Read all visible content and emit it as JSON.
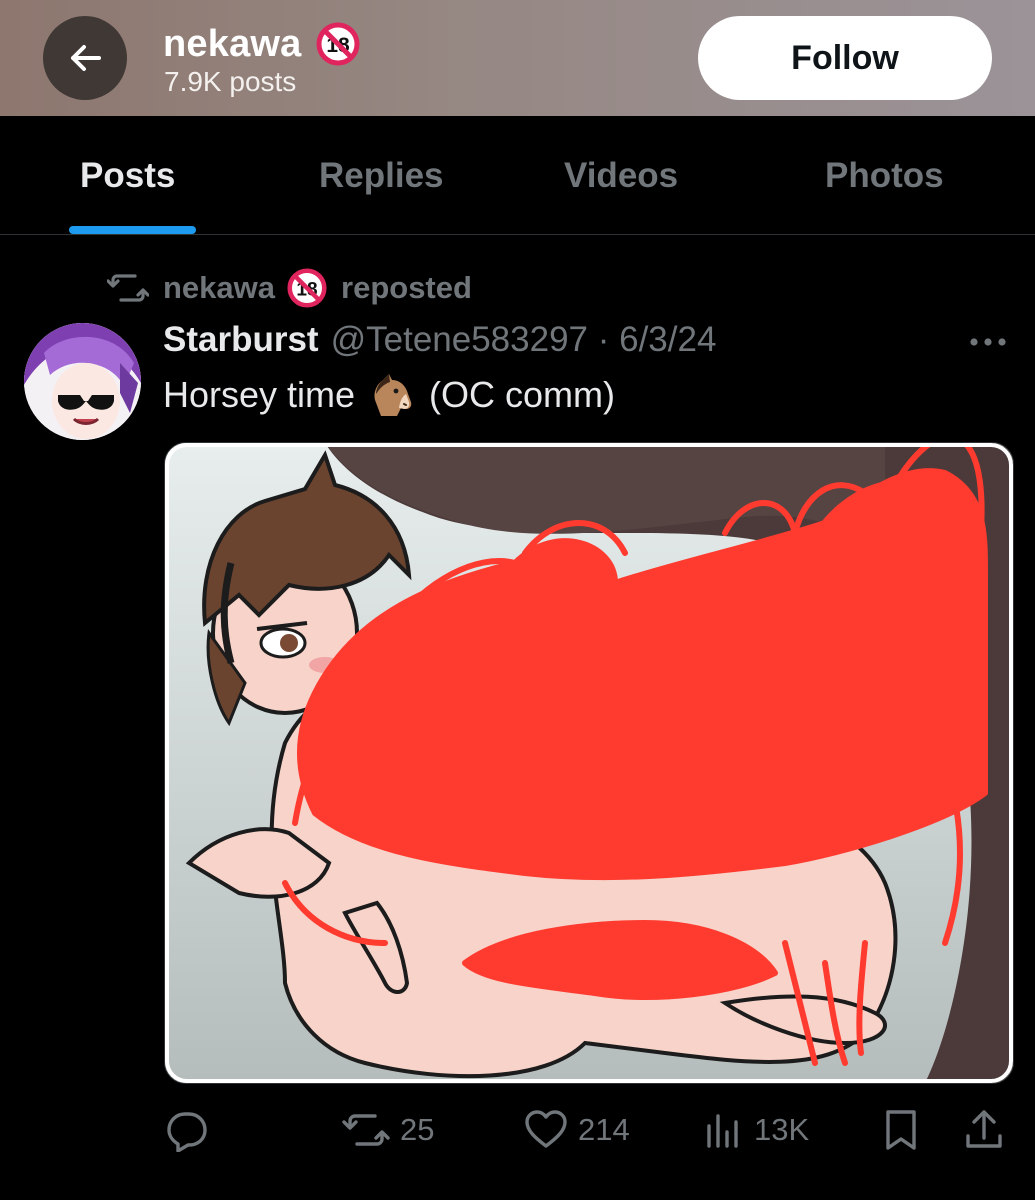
{
  "header": {
    "profile_name": "nekawa",
    "posts_count": "7.9K posts",
    "follow_label": "Follow"
  },
  "tabs": [
    {
      "label": "Posts",
      "active": true
    },
    {
      "label": "Replies",
      "active": false
    },
    {
      "label": "Videos",
      "active": false
    },
    {
      "label": "Photos",
      "active": false
    }
  ],
  "post": {
    "repost_by": "nekawa",
    "repost_label": "reposted",
    "author_name": "Starburst",
    "handle_date": "@Tetene583297 · 6/3/24",
    "text_before": "Horsey time",
    "text_after": "(OC comm)",
    "stats": {
      "reposts": "25",
      "likes": "214",
      "views": "13K"
    }
  },
  "icons": {
    "back": "arrow-left-icon",
    "adult_badge": "no-under-18-icon",
    "repost": "repost-icon",
    "more": "more-horizontal-icon",
    "emoji": "horse-face-emoji",
    "reply": "reply-icon",
    "like": "heart-icon",
    "views": "views-chart-icon",
    "bookmark": "bookmark-icon",
    "share": "share-icon"
  },
  "colors": {
    "accent": "#1d9bf0",
    "background": "#000000",
    "muted_text": "#71767b",
    "censor_scribble": "#ff3b30"
  }
}
